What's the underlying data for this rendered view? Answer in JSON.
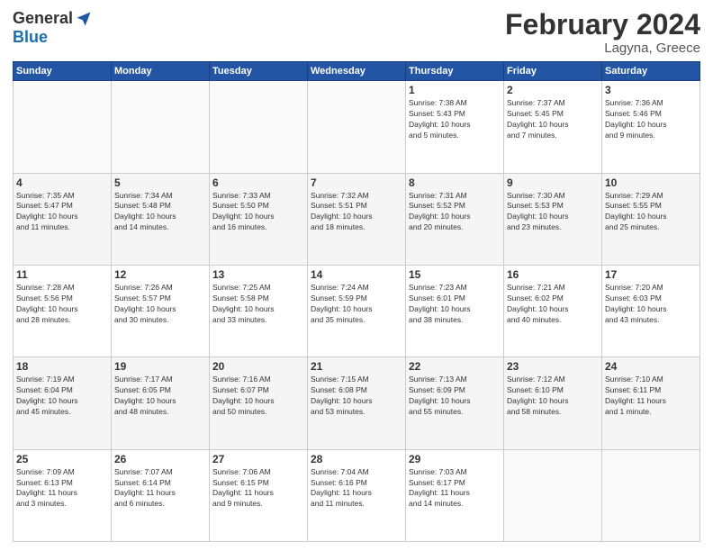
{
  "logo": {
    "general": "General",
    "blue": "Blue"
  },
  "title": "February 2024",
  "location": "Lagyna, Greece",
  "headers": [
    "Sunday",
    "Monday",
    "Tuesday",
    "Wednesday",
    "Thursday",
    "Friday",
    "Saturday"
  ],
  "weeks": [
    [
      {
        "day": "",
        "info": ""
      },
      {
        "day": "",
        "info": ""
      },
      {
        "day": "",
        "info": ""
      },
      {
        "day": "",
        "info": ""
      },
      {
        "day": "1",
        "info": "Sunrise: 7:38 AM\nSunset: 5:43 PM\nDaylight: 10 hours\nand 5 minutes."
      },
      {
        "day": "2",
        "info": "Sunrise: 7:37 AM\nSunset: 5:45 PM\nDaylight: 10 hours\nand 7 minutes."
      },
      {
        "day": "3",
        "info": "Sunrise: 7:36 AM\nSunset: 5:46 PM\nDaylight: 10 hours\nand 9 minutes."
      }
    ],
    [
      {
        "day": "4",
        "info": "Sunrise: 7:35 AM\nSunset: 5:47 PM\nDaylight: 10 hours\nand 11 minutes."
      },
      {
        "day": "5",
        "info": "Sunrise: 7:34 AM\nSunset: 5:48 PM\nDaylight: 10 hours\nand 14 minutes."
      },
      {
        "day": "6",
        "info": "Sunrise: 7:33 AM\nSunset: 5:50 PM\nDaylight: 10 hours\nand 16 minutes."
      },
      {
        "day": "7",
        "info": "Sunrise: 7:32 AM\nSunset: 5:51 PM\nDaylight: 10 hours\nand 18 minutes."
      },
      {
        "day": "8",
        "info": "Sunrise: 7:31 AM\nSunset: 5:52 PM\nDaylight: 10 hours\nand 20 minutes."
      },
      {
        "day": "9",
        "info": "Sunrise: 7:30 AM\nSunset: 5:53 PM\nDaylight: 10 hours\nand 23 minutes."
      },
      {
        "day": "10",
        "info": "Sunrise: 7:29 AM\nSunset: 5:55 PM\nDaylight: 10 hours\nand 25 minutes."
      }
    ],
    [
      {
        "day": "11",
        "info": "Sunrise: 7:28 AM\nSunset: 5:56 PM\nDaylight: 10 hours\nand 28 minutes."
      },
      {
        "day": "12",
        "info": "Sunrise: 7:26 AM\nSunset: 5:57 PM\nDaylight: 10 hours\nand 30 minutes."
      },
      {
        "day": "13",
        "info": "Sunrise: 7:25 AM\nSunset: 5:58 PM\nDaylight: 10 hours\nand 33 minutes."
      },
      {
        "day": "14",
        "info": "Sunrise: 7:24 AM\nSunset: 5:59 PM\nDaylight: 10 hours\nand 35 minutes."
      },
      {
        "day": "15",
        "info": "Sunrise: 7:23 AM\nSunset: 6:01 PM\nDaylight: 10 hours\nand 38 minutes."
      },
      {
        "day": "16",
        "info": "Sunrise: 7:21 AM\nSunset: 6:02 PM\nDaylight: 10 hours\nand 40 minutes."
      },
      {
        "day": "17",
        "info": "Sunrise: 7:20 AM\nSunset: 6:03 PM\nDaylight: 10 hours\nand 43 minutes."
      }
    ],
    [
      {
        "day": "18",
        "info": "Sunrise: 7:19 AM\nSunset: 6:04 PM\nDaylight: 10 hours\nand 45 minutes."
      },
      {
        "day": "19",
        "info": "Sunrise: 7:17 AM\nSunset: 6:05 PM\nDaylight: 10 hours\nand 48 minutes."
      },
      {
        "day": "20",
        "info": "Sunrise: 7:16 AM\nSunset: 6:07 PM\nDaylight: 10 hours\nand 50 minutes."
      },
      {
        "day": "21",
        "info": "Sunrise: 7:15 AM\nSunset: 6:08 PM\nDaylight: 10 hours\nand 53 minutes."
      },
      {
        "day": "22",
        "info": "Sunrise: 7:13 AM\nSunset: 6:09 PM\nDaylight: 10 hours\nand 55 minutes."
      },
      {
        "day": "23",
        "info": "Sunrise: 7:12 AM\nSunset: 6:10 PM\nDaylight: 10 hours\nand 58 minutes."
      },
      {
        "day": "24",
        "info": "Sunrise: 7:10 AM\nSunset: 6:11 PM\nDaylight: 11 hours\nand 1 minute."
      }
    ],
    [
      {
        "day": "25",
        "info": "Sunrise: 7:09 AM\nSunset: 6:13 PM\nDaylight: 11 hours\nand 3 minutes."
      },
      {
        "day": "26",
        "info": "Sunrise: 7:07 AM\nSunset: 6:14 PM\nDaylight: 11 hours\nand 6 minutes."
      },
      {
        "day": "27",
        "info": "Sunrise: 7:06 AM\nSunset: 6:15 PM\nDaylight: 11 hours\nand 9 minutes."
      },
      {
        "day": "28",
        "info": "Sunrise: 7:04 AM\nSunset: 6:16 PM\nDaylight: 11 hours\nand 11 minutes."
      },
      {
        "day": "29",
        "info": "Sunrise: 7:03 AM\nSunset: 6:17 PM\nDaylight: 11 hours\nand 14 minutes."
      },
      {
        "day": "",
        "info": ""
      },
      {
        "day": "",
        "info": ""
      }
    ]
  ]
}
